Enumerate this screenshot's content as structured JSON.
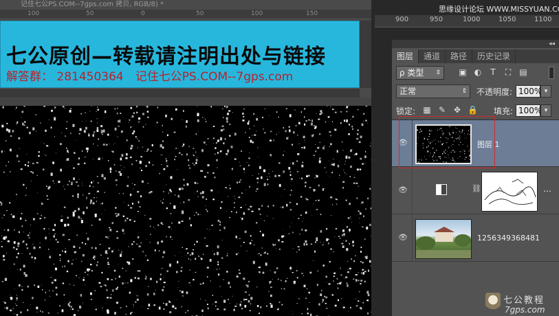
{
  "document": {
    "title": "记住七公PS.COM--7gps.com 拷贝, RGB/8) *",
    "ruler_ticks": [
      "100",
      "50",
      "0",
      "50",
      "100",
      "150"
    ]
  },
  "banner": {
    "title": "七公原创—转载请注明出处与链接",
    "subtitle": "解答群： 281450364　记住七公PS.COM--7gps.com"
  },
  "top_ruler": {
    "ticks": [
      "900",
      "950",
      "1000",
      "1050",
      "1100"
    ]
  },
  "watermark": {
    "top": "思缘设计论坛 WWW.MISSYUAN.COM",
    "bottom_line1": "七公教程",
    "bottom_line2": "7gps.com"
  },
  "panel": {
    "collapse_glyph": "◂◂",
    "tabs": [
      {
        "label": "图层",
        "active": true
      },
      {
        "label": "通道",
        "active": false
      },
      {
        "label": "路径",
        "active": false
      },
      {
        "label": "历史记录",
        "active": false
      }
    ],
    "filter": {
      "label": "ρ 类型",
      "icons": [
        "image-filter-icon",
        "adjustment-filter-icon",
        "type-filter-icon",
        "shape-filter-icon",
        "smart-object-filter-icon"
      ]
    },
    "blend_mode": "正常",
    "opacity_label": "不透明度:",
    "opacity_value": "100%",
    "lock_label": "锁定:",
    "fill_label": "填充:",
    "fill_value": "100%",
    "layers": [
      {
        "name": "图层 1",
        "selected": true
      },
      {
        "name": "",
        "selected": false
      },
      {
        "name": "1256349368481",
        "selected": false
      }
    ]
  },
  "colors": {
    "banner_bg": "#27b7dd",
    "banner_sub": "#b8222a",
    "selected_layer": "#6d7d96",
    "selection_outline": "#d12a2a"
  }
}
